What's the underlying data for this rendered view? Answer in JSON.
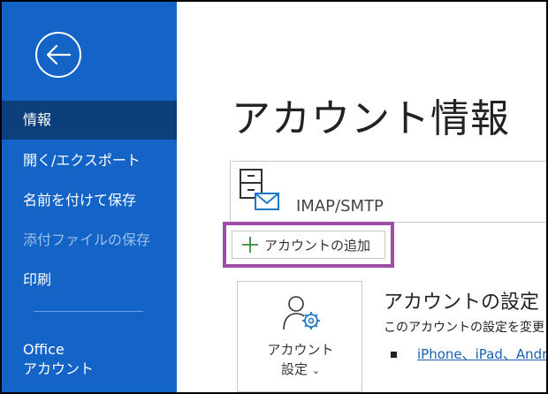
{
  "sidebar": {
    "back_icon": "arrow-left-icon",
    "items": [
      {
        "label": "情報",
        "state": "active"
      },
      {
        "label": "開く/エクスポート",
        "state": "normal"
      },
      {
        "label": "名前を付けて保存",
        "state": "normal"
      },
      {
        "label": "添付ファイルの保存",
        "state": "disabled"
      },
      {
        "label": "印刷",
        "state": "normal"
      }
    ],
    "office_account": {
      "line1": "Office",
      "line2": "アカウント"
    }
  },
  "main": {
    "title": "アカウント情報",
    "account": {
      "type": "IMAP/SMTP",
      "icon": "mailbox-icon"
    },
    "add_account": {
      "label": "アカウントの追加",
      "icon": "plus-icon"
    },
    "settings": {
      "tile_line1": "アカウント",
      "tile_line2": "設定",
      "tile_icon": "user-gear-icon",
      "heading": "アカウントの設定",
      "description": "このアカウントの設定を変更",
      "link": "iPhone、iPad、Andr"
    }
  },
  "colors": {
    "sidebar_bg": "#1464c8",
    "sidebar_active": "#0d3f7c",
    "highlight_border": "#9d4fa8",
    "link": "#1a5fb4",
    "plus_green": "#3a8a3a"
  }
}
